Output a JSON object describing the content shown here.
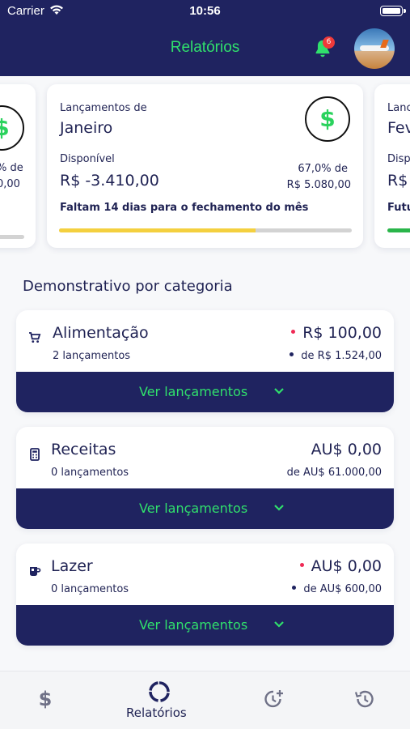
{
  "status_bar": {
    "carrier": "Carrier",
    "time": "10:56"
  },
  "header": {
    "title": "Relatórios",
    "notification_count": "6"
  },
  "cards": {
    "left": {
      "pct": "% de",
      "total": "0,00"
    },
    "center": {
      "label": "Lançamentos de",
      "month": "Janeiro",
      "available_label": "Disponível",
      "amount": "R$ -3.410,00",
      "pct": "67,0% de",
      "total": "R$ 5.080,00",
      "note": "Faltam 14 dias para o fechamento do mês",
      "progress": 0.67,
      "progress_color": "#f4d03f"
    },
    "right": {
      "label": "Lanc",
      "month": "Fev",
      "available_label": "Disp",
      "amount": "R$",
      "note": "Futu",
      "progress_color": "#2ab54a"
    }
  },
  "section_title": "Demonstrativo por categoria",
  "categories": [
    {
      "name": "Alimentação",
      "count": "2 lançamentos",
      "value": "R$ 100,00",
      "budget": "de R$ 1.524,00",
      "value_dot": true,
      "budget_dot": true,
      "icon": "cart-icon",
      "button": "Ver lançamentos"
    },
    {
      "name": "Receitas",
      "count": "0 lançamentos",
      "value": "AU$ 0,00",
      "budget": "de AU$ 61.000,00",
      "value_dot": false,
      "budget_dot": false,
      "icon": "calculator-icon",
      "button": "Ver lançamentos"
    },
    {
      "name": "Lazer",
      "count": "0 lançamentos",
      "value": "AU$ 0,00",
      "budget": "de AU$ 600,00",
      "value_dot": true,
      "budget_dot": true,
      "icon": "mug-icon",
      "button": "Ver lançamentos"
    }
  ],
  "tabbar": {
    "items": [
      {
        "icon": "dollar-icon",
        "label": ""
      },
      {
        "icon": "reports-ring-icon",
        "label": "Relatórios",
        "active": true
      },
      {
        "icon": "history-add-icon",
        "label": ""
      },
      {
        "icon": "history-icon",
        "label": ""
      }
    ]
  },
  "colors": {
    "navy": "#1f2360",
    "green": "#30e06c",
    "red_dot": "#ef2a55",
    "progress_yellow": "#f4d03f"
  }
}
